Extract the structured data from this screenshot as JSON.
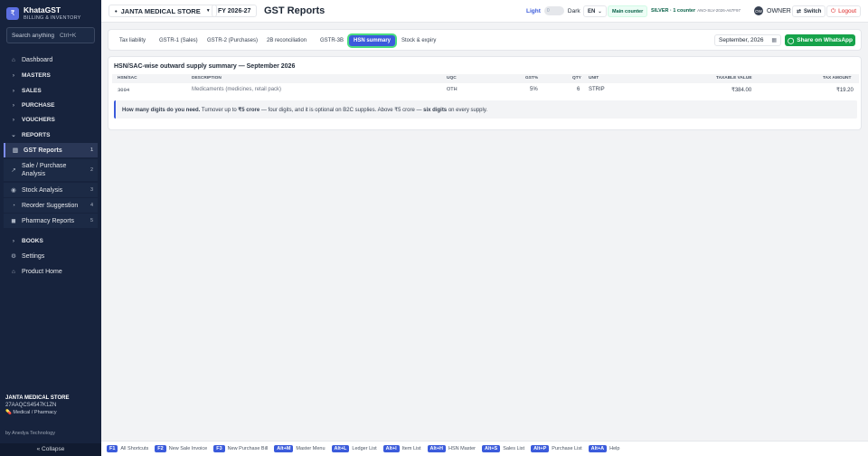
{
  "app": {
    "logo": "₹",
    "title": "KhataGST",
    "subtitle": "BILLING & INVENTORY"
  },
  "search": {
    "placeholder": "Search anything",
    "shortcut": "Ctrl+K"
  },
  "sidebar": {
    "items": [
      {
        "label": "Dashboard",
        "icon": "⌂"
      },
      {
        "label": "MASTERS",
        "icon": "›"
      },
      {
        "label": "SALES",
        "icon": "›"
      },
      {
        "label": "PURCHASE",
        "icon": "›"
      },
      {
        "label": "VOUCHERS",
        "icon": "›"
      },
      {
        "label": "REPORTS",
        "icon": "⌄"
      },
      {
        "label": "BOOKS",
        "icon": "›"
      },
      {
        "label": "Settings",
        "icon": "⚙"
      },
      {
        "label": "Product Home",
        "icon": "⌂"
      }
    ],
    "reports": [
      {
        "label": "GST Reports",
        "count": "1",
        "icon": "▥"
      },
      {
        "label": "Sale / Purchase Analysis",
        "count": "2",
        "icon": "↗"
      },
      {
        "label": "Stock Analysis",
        "count": "3",
        "icon": "◉"
      },
      {
        "label": "Reorder Suggestion",
        "count": "4",
        "icon": "◔"
      },
      {
        "label": "Pharmacy Reports",
        "count": "5",
        "icon": "◼"
      }
    ],
    "footer": {
      "store": "JANTA MEDICAL STORE",
      "gstin": "27AAQCS4547K1ZN",
      "type": "Medical / Pharmacy",
      "by": "by Anedya Technology",
      "collapse": "« Collapse"
    }
  },
  "topbar": {
    "store": "JANTA MEDICAL STORE",
    "fy": "FY 2026-27",
    "title": "GST Reports",
    "light": "Light",
    "toggle_value": "0",
    "dark": "Dark",
    "lang": "EN",
    "counter": "Main counter",
    "plan": "SILVER · 1 counter",
    "plan_code": "ANO-SLV-2026-A67F97",
    "avatar": "OW",
    "role": "OWNER",
    "switch": "Switch",
    "logout": "Logout"
  },
  "tabs": [
    "Tax liability",
    "GSTR-1 (Sales)",
    "GSTR-2 (Purchases)",
    "2B reconciliation",
    "GSTR-3B",
    "HSN summary",
    "Stock & expiry"
  ],
  "active_tab": "HSN summary",
  "period": {
    "month": "September, 2026"
  },
  "share_label": "Share on WhatsApp",
  "hsn": {
    "title": "HSN/SAC-wise outward supply summary — September 2026",
    "columns": [
      "HSN/SAC",
      "DESCRIPTION",
      "UQC",
      "GST%",
      "QTY",
      "UNIT",
      "TAXABLE VALUE",
      "TAX AMOUNT"
    ],
    "rows": [
      {
        "hsn": "3004",
        "description": "Medicaments (medicines, retail pack)",
        "uqc": "OTH",
        "gst": "5%",
        "qty": "6",
        "unit": "STRIP",
        "taxable": "₹384.00",
        "tax": "₹19.20"
      }
    ],
    "note": {
      "q": "How many digits do you need.",
      "t1": " Turnover up to ",
      "b1": "₹5 crore",
      "t2": " — four digits, and it is optional on B2C supplies. Above ₹5 crore — ",
      "b2": "six digits",
      "t3": " on every supply."
    }
  },
  "shortcuts": [
    {
      "key": "F1",
      "label": "All Shortcuts"
    },
    {
      "key": "F2",
      "label": "New Sale Invoice"
    },
    {
      "key": "F3",
      "label": "New Purchase Bill"
    },
    {
      "key": "Alt+M",
      "label": "Master Menu"
    },
    {
      "key": "Alt+L",
      "label": "Ledger List"
    },
    {
      "key": "Alt+I",
      "label": "Item List"
    },
    {
      "key": "Alt+H",
      "label": "HSN Master"
    },
    {
      "key": "Alt+S",
      "label": "Sales List"
    },
    {
      "key": "Alt+P",
      "label": "Purchase List"
    },
    {
      "key": "Alt+A",
      "label": "Help"
    }
  ],
  "colors": {
    "sidebar": "#17233d",
    "accent": "#3b5bdb",
    "whatsapp": "#16a34a",
    "logout": "#dc2626"
  }
}
